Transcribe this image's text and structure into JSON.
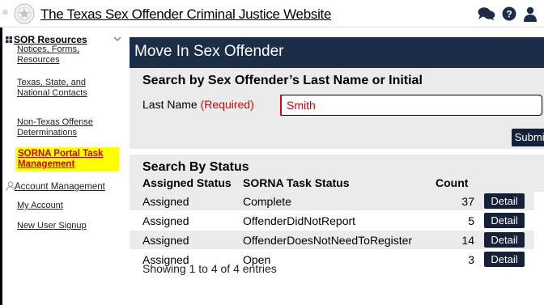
{
  "header": {
    "title": "The Texas Sex Offender Criminal Justice Website"
  },
  "sidebar": {
    "section_label": "SOR Resources",
    "items": [
      {
        "label": "Notices, Forms, Resources"
      },
      {
        "label": "Texas, State, and National Contacts"
      },
      {
        "label": "Non-Texas Offense Determinations"
      },
      {
        "label": "SORNA Portal Task Management",
        "active": true
      }
    ],
    "account_label": "Account Management",
    "account_items": [
      {
        "label": "My Account"
      },
      {
        "label": "New User Signup"
      }
    ]
  },
  "main": {
    "title": "Move In Sex Offender",
    "search": {
      "heading": "Search by Sex Offender’s Last Name or Initial",
      "field_label": "Last Name",
      "required_text": "(Required)",
      "value": "Smith",
      "submit_label": "Submit"
    },
    "status": {
      "heading": "Search By Status",
      "columns": [
        "Assigned Status",
        "SORNA Task Status",
        "Count"
      ],
      "rows": [
        {
          "assigned": "Assigned",
          "task_status": "Complete",
          "count": "37",
          "action": "Detail"
        },
        {
          "assigned": "Assigned",
          "task_status": "OffenderDidNotReport",
          "count": "5",
          "action": "Detail"
        },
        {
          "assigned": "Assigned",
          "task_status": "OffenderDoesNotNeedToRegister",
          "count": "14",
          "action": "Detail"
        },
        {
          "assigned": "Assigned",
          "task_status": "Open",
          "count": "3",
          "action": "Detail"
        }
      ],
      "info": "Showing 1 to 4 of 4 entries"
    }
  },
  "colors": {
    "title_bar": "#1b2d47",
    "button": "#15213a",
    "panel_bg": "#ebebeb",
    "required": "#e00000",
    "active_highlight": "#ffff00"
  }
}
